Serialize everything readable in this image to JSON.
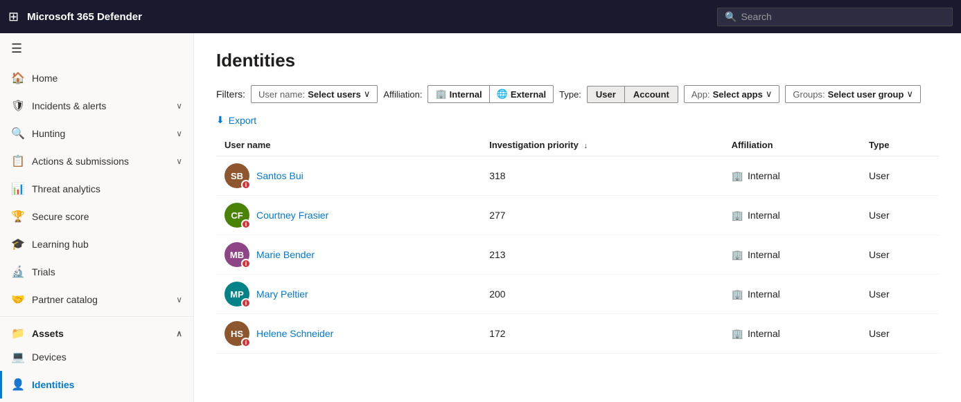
{
  "app": {
    "title": "Microsoft 365 Defender",
    "search_placeholder": "Search"
  },
  "sidebar": {
    "toggle_icon": "☰",
    "items": [
      {
        "id": "home",
        "label": "Home",
        "icon": "🏠",
        "has_chevron": false,
        "active": false
      },
      {
        "id": "incidents-alerts",
        "label": "Incidents & alerts",
        "icon": "🛡",
        "has_chevron": true,
        "active": false
      },
      {
        "id": "hunting",
        "label": "Hunting",
        "icon": "🔍",
        "has_chevron": true,
        "active": false
      },
      {
        "id": "actions-submissions",
        "label": "Actions & submissions",
        "icon": "📋",
        "has_chevron": true,
        "active": false
      },
      {
        "id": "threat-analytics",
        "label": "Threat analytics",
        "icon": "📊",
        "has_chevron": false,
        "active": false
      },
      {
        "id": "secure-score",
        "label": "Secure score",
        "icon": "🏆",
        "has_chevron": false,
        "active": false
      },
      {
        "id": "learning-hub",
        "label": "Learning hub",
        "icon": "🎓",
        "has_chevron": false,
        "active": false
      },
      {
        "id": "trials",
        "label": "Trials",
        "icon": "🔬",
        "has_chevron": false,
        "active": false
      },
      {
        "id": "partner-catalog",
        "label": "Partner catalog",
        "icon": "🤝",
        "has_chevron": true,
        "active": false
      }
    ],
    "assets_section": {
      "label": "Assets",
      "items": [
        {
          "id": "devices",
          "label": "Devices",
          "icon": "💻",
          "has_chevron": false,
          "active": false
        },
        {
          "id": "identities",
          "label": "Identities",
          "icon": "👤",
          "has_chevron": false,
          "active": true
        }
      ]
    }
  },
  "page": {
    "title": "Identities",
    "filters_label": "Filters:",
    "username_filter_label": "User name:",
    "username_filter_value": "Select users",
    "affiliation_label": "Affiliation:",
    "affiliation_internal": "Internal",
    "affiliation_external": "External",
    "type_label": "Type:",
    "type_user": "User",
    "type_account": "Account",
    "app_label": "App:",
    "app_value": "Select apps",
    "groups_label": "Groups:",
    "groups_value": "Select user group",
    "export_label": "Export",
    "table": {
      "columns": [
        {
          "id": "username",
          "label": "User name",
          "sortable": false
        },
        {
          "id": "investigation_priority",
          "label": "Investigation priority",
          "sortable": true
        },
        {
          "id": "affiliation",
          "label": "Affiliation",
          "sortable": false
        },
        {
          "id": "type",
          "label": "Type",
          "sortable": false
        }
      ],
      "rows": [
        {
          "id": "santos-bui",
          "name": "Santos Bui",
          "initials": "SB",
          "avatar_color": "sb",
          "has_photo": true,
          "investigation_priority": "318",
          "affiliation": "Internal",
          "type": "User"
        },
        {
          "id": "courtney-frasier",
          "name": "Courtney Frasier",
          "initials": "CF",
          "avatar_color": "cf",
          "has_photo": false,
          "investigation_priority": "277",
          "affiliation": "Internal",
          "type": "User"
        },
        {
          "id": "marie-bender",
          "name": "Marie Bender",
          "initials": "MB",
          "avatar_color": "mb",
          "has_photo": false,
          "investigation_priority": "213",
          "affiliation": "Internal",
          "type": "User"
        },
        {
          "id": "mary-peltier",
          "name": "Mary Peltier",
          "initials": "MP",
          "avatar_color": "mp",
          "has_photo": false,
          "investigation_priority": "200",
          "affiliation": "Internal",
          "type": "User"
        },
        {
          "id": "helene-schneider",
          "name": "Helene Schneider",
          "initials": "HS",
          "avatar_color": "hs",
          "has_photo": true,
          "investigation_priority": "172",
          "affiliation": "Internal",
          "type": "User"
        }
      ]
    }
  }
}
